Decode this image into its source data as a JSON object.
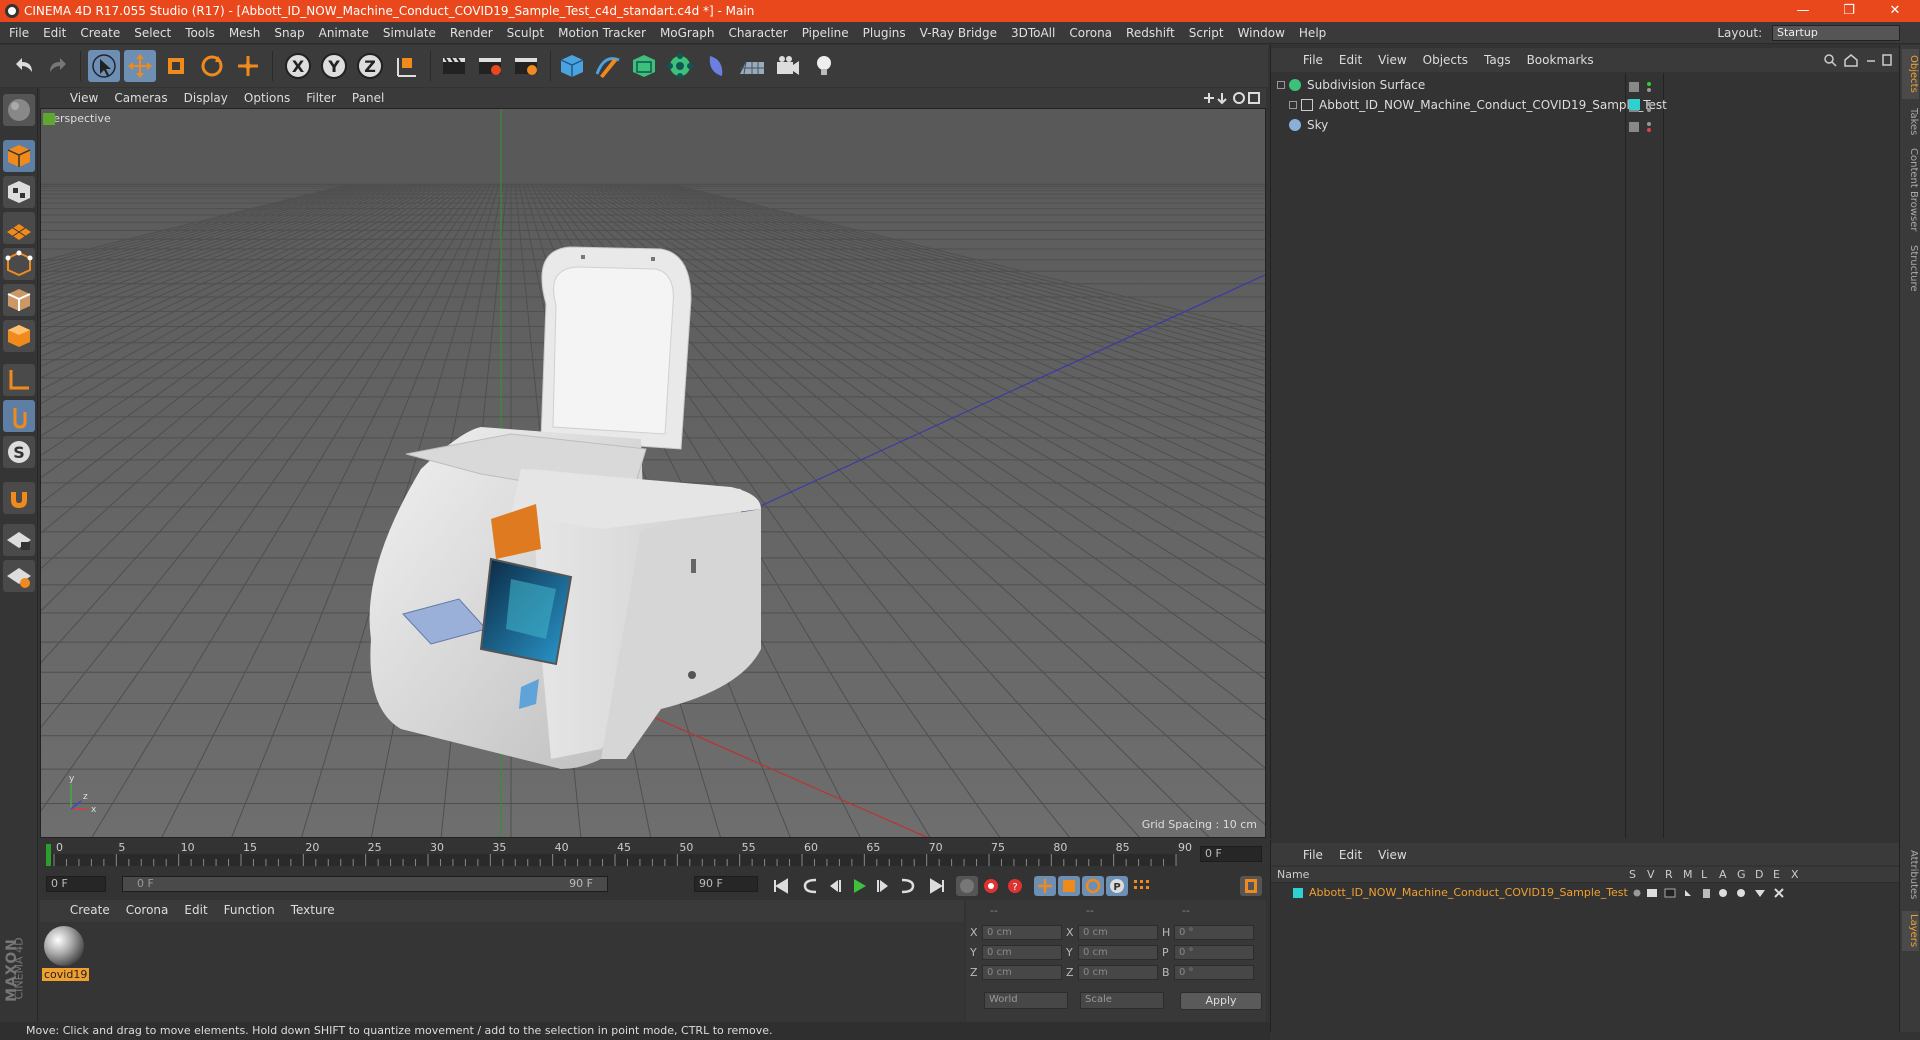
{
  "window": {
    "title": "CINEMA 4D R17.055 Studio (R17) - [Abbott_ID_NOW_Machine_Conduct_COVID19_Sample_Test_c4d_standart.c4d *] - Main",
    "minimize": "—",
    "restore": "❐",
    "close": "✕"
  },
  "menubar": {
    "items": [
      "File",
      "Edit",
      "Create",
      "Select",
      "Tools",
      "Mesh",
      "Snap",
      "Animate",
      "Simulate",
      "Render",
      "Sculpt",
      "Motion Tracker",
      "MoGraph",
      "Character",
      "Pipeline",
      "Plugins",
      "V-Ray Bridge",
      "3DToAll",
      "Corona",
      "Redshift",
      "Script",
      "Window",
      "Help"
    ],
    "layout_label": "Layout:",
    "layout_value": "Startup"
  },
  "toolbar": {
    "axis_x": "X",
    "axis_y": "Y",
    "axis_z": "Z"
  },
  "viewport": {
    "menu": [
      "View",
      "Cameras",
      "Display",
      "Options",
      "Filter",
      "Panel"
    ],
    "label": "Perspective",
    "grid_spacing": "Grid Spacing : 10 cm",
    "axis_y": "y",
    "axis_x": "x",
    "axis_z": "z"
  },
  "timeline": {
    "ticks": [
      "0",
      "5",
      "10",
      "15",
      "20",
      "25",
      "30",
      "35",
      "40",
      "45",
      "50",
      "55",
      "60",
      "65",
      "70",
      "75",
      "80",
      "85",
      "90"
    ],
    "current_frame_field": "0 F",
    "start_field": "0 F",
    "range_start": "0 F",
    "range_end": "90 F",
    "end_field": "90 F"
  },
  "material_manager": {
    "menu": [
      "Create",
      "Corona",
      "Edit",
      "Function",
      "Texture"
    ],
    "material_name": "covid19",
    "maxon_text": "MAXON",
    "c4d_text": "CINEMA 4D"
  },
  "coordinates": {
    "header": [
      "--",
      "--",
      "--"
    ],
    "rows": [
      {
        "a": "X",
        "av": "0 cm",
        "b": "X",
        "bv": "0 cm",
        "c": "H",
        "cv": "0 °"
      },
      {
        "a": "Y",
        "av": "0 cm",
        "b": "Y",
        "bv": "0 cm",
        "c": "P",
        "cv": "0 °"
      },
      {
        "a": "Z",
        "av": "0 cm",
        "b": "Z",
        "bv": "0 cm",
        "c": "B",
        "cv": "0 °"
      }
    ],
    "mode1": "World",
    "mode2": "Scale",
    "apply": "Apply"
  },
  "object_manager": {
    "menu": [
      "File",
      "Edit",
      "View",
      "Objects",
      "Tags",
      "Bookmarks"
    ],
    "objects": [
      {
        "name": "Subdivision Surface"
      },
      {
        "name": "Abbott_ID_NOW_Machine_Conduct_COVID19_Sample_Test"
      },
      {
        "name": "Sky"
      }
    ]
  },
  "layer_manager": {
    "menu": [
      "File",
      "Edit",
      "View"
    ],
    "col_name": "Name",
    "cols": [
      "S",
      "V",
      "R",
      "M",
      "L",
      "A",
      "G",
      "D",
      "E",
      "X"
    ],
    "layer_name": "Abbott_ID_NOW_Machine_Conduct_COVID19_Sample_Test"
  },
  "right_tabs": [
    "Objects",
    "Takes",
    "Content Browser",
    "Structure"
  ],
  "right_tabs_bottom": [
    "Attributes",
    "Layers"
  ],
  "status": "Move: Click and drag to move elements. Hold down SHIFT to quantize movement / add to the selection in point mode, CTRL to remove.",
  "colors": {
    "accent": "#e8481b",
    "selected": "#6d8fb3",
    "layer_text": "#f0a030",
    "cyan": "#2fd0d0"
  }
}
